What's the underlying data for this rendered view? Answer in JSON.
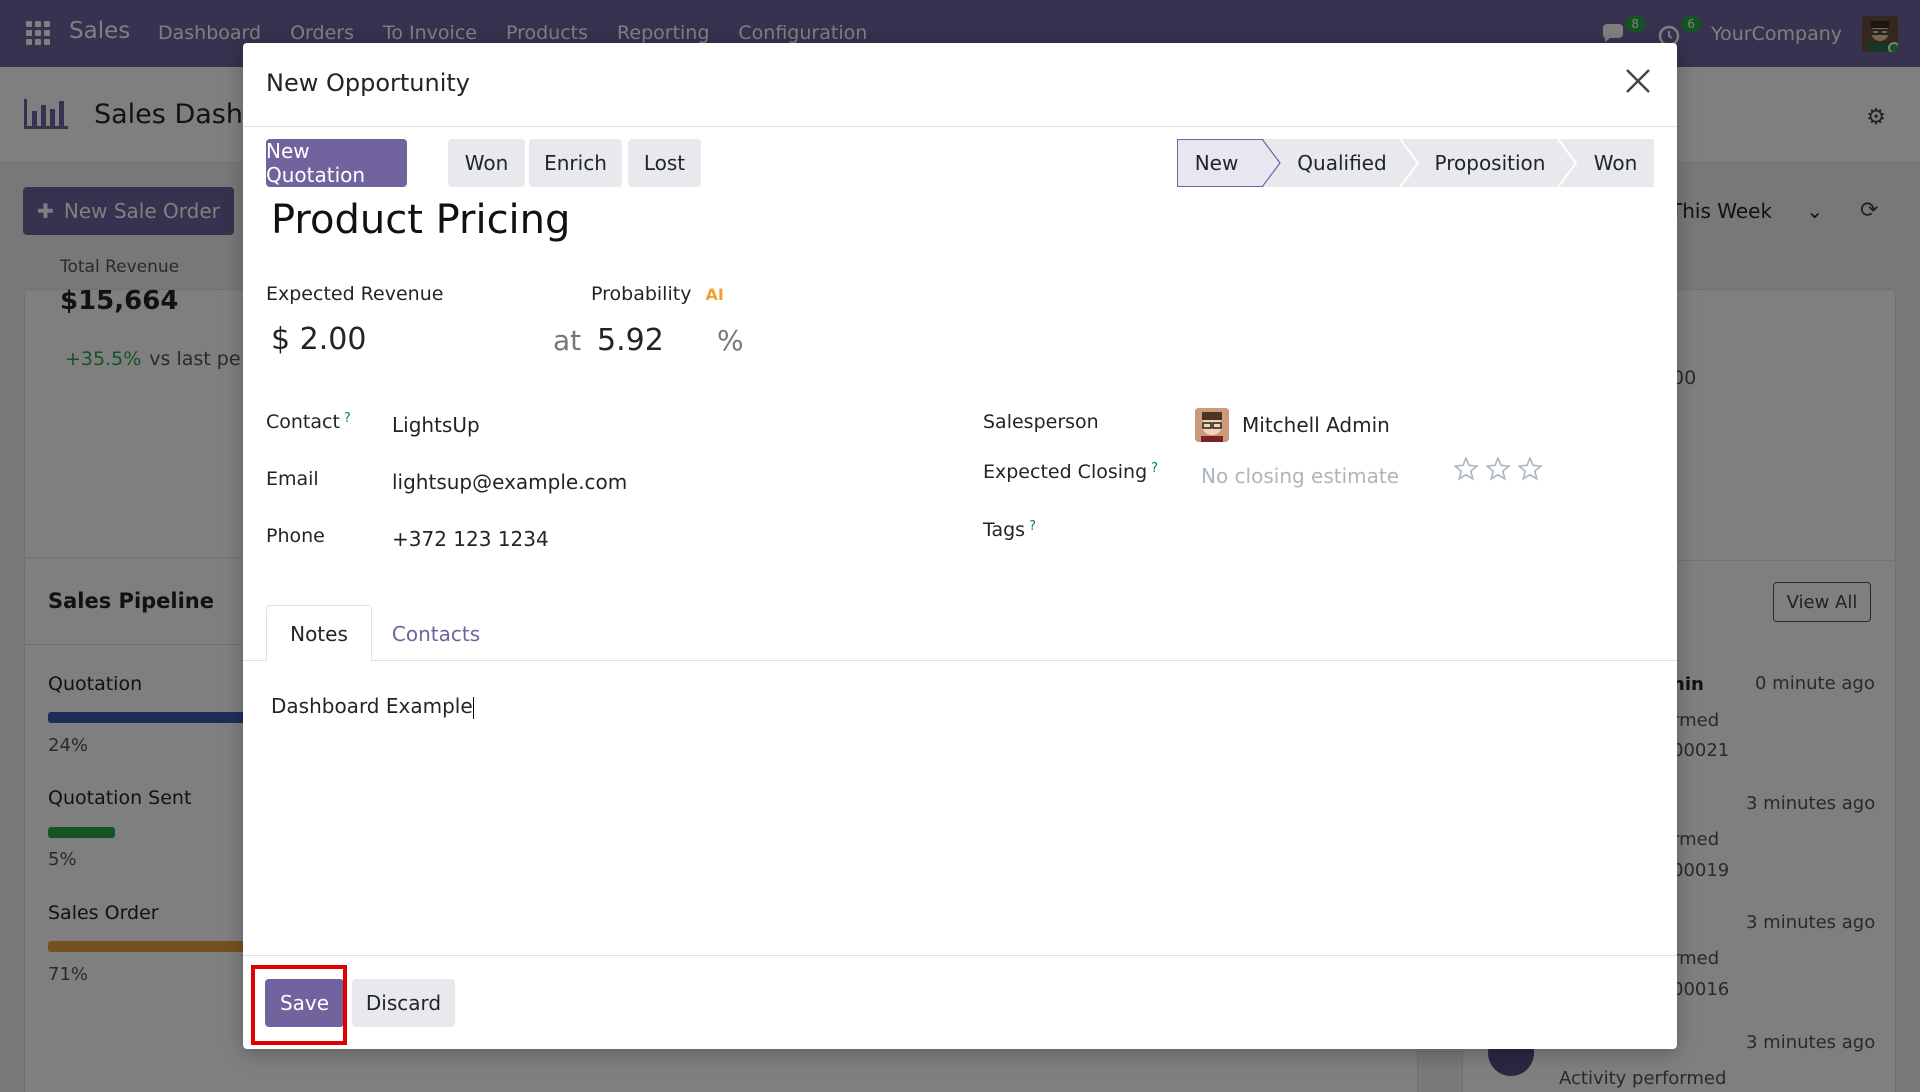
{
  "topnav": {
    "brand": "Sales",
    "menu": [
      "Dashboard",
      "Orders",
      "To Invoice",
      "Products",
      "Reporting",
      "Configuration"
    ],
    "chat_badge": "8",
    "activity_badge": "6",
    "company": "YourCompany"
  },
  "background": {
    "title": "Sales Dashb",
    "new_sale_order": "New Sale Order",
    "period": "This Week",
    "total_revenue_label": "Total Revenue",
    "total_revenue_value": "$15,664",
    "revenue_delta": "+35.5%",
    "revenue_delta_suffix": "vs last pe",
    "right_card_value": "00",
    "pipeline_title": "Sales Pipeline",
    "pipeline": [
      {
        "label": "Quotation",
        "pct": "24%",
        "share": 0.24,
        "color": "#3b5bb5"
      },
      {
        "label": "Quotation Sent",
        "pct": "5%",
        "share": 0.05,
        "color": "#28a745"
      },
      {
        "label": "Sales Order",
        "pct": "71%",
        "share": 0.71,
        "color": "#e8a33c"
      }
    ],
    "view_all": "View All",
    "activity_name_fragment": "nin",
    "activity_times": [
      "0 minute ago",
      "3 minutes ago",
      "3 minutes ago",
      "3 minutes ago"
    ],
    "activity_fragments": [
      "rmed",
      "00021",
      "rmed",
      "00019",
      "rmed",
      "00016"
    ],
    "activity_last": "Activity performed"
  },
  "modal": {
    "title": "New Opportunity",
    "buttons": {
      "new_quotation": "New Quotation",
      "won": "Won",
      "enrich": "Enrich",
      "lost": "Lost"
    },
    "stages": [
      "New",
      "Qualified",
      "Proposition",
      "Won"
    ],
    "active_stage": "New",
    "record_title": "Product Pricing",
    "expected_revenue_label": "Expected Revenue",
    "expected_revenue": "$ 2.00",
    "at_label": "at",
    "probability_label": "Probability",
    "ai_label": "AI",
    "probability": "5.92",
    "percent_sign": "%",
    "contact_label": "Contact",
    "contact": "LightsUp",
    "email_label": "Email",
    "email": "lightsup@example.com",
    "phone_label": "Phone",
    "phone": "+372 123 1234",
    "salesperson_label": "Salesperson",
    "salesperson": "Mitchell Admin",
    "expected_closing_label": "Expected Closing",
    "expected_closing_placeholder": "No closing estimate",
    "priority_stars": 0,
    "tags_label": "Tags",
    "help_mark": "?",
    "tabs": [
      "Notes",
      "Contacts"
    ],
    "notes": "Dashboard Example",
    "save": "Save",
    "discard": "Discard"
  },
  "colors": {
    "brand": "#71639e",
    "highlight": "#e00000"
  }
}
